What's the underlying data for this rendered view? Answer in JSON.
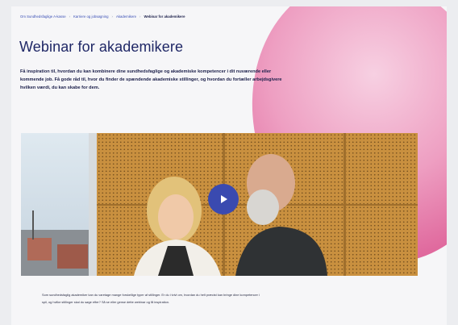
{
  "breadcrumb": {
    "items": [
      "Om Sundhedsfaglige A-kasse",
      "Karriere og jobsøgning",
      "Akademikere"
    ],
    "current": "Webinar for akademikere"
  },
  "header": {
    "title": "Webinar for akademikere"
  },
  "intro": {
    "text": "Få inspiration til, hvordan du kan kombinere dine sundhedsfaglige og akademiske kompetencer i dit nuværende eller kommende job. Få gode råd til, hvor du finder de spændende akademiske stillinger, og hvordan du fortæller arbejdsgivere hvilken værdi, du kan skabe for dem."
  },
  "video": {
    "play_icon": "play-icon"
  },
  "body": {
    "text": "Som sundhedsfaglig akademiker kan du varetage mange forskellige typer af stillinger. Er du i tvivl om, hvordan du helt præcist kan bringe dine kompetencer i spil, og hvilke stillinger skal du søge efter? Så se eller gense dette webinar og få inspiration."
  },
  "colors": {
    "accent": "#1f2766",
    "link": "#3a4fb5",
    "play_button": "#3a4ab0",
    "blob": "#e782b0"
  }
}
